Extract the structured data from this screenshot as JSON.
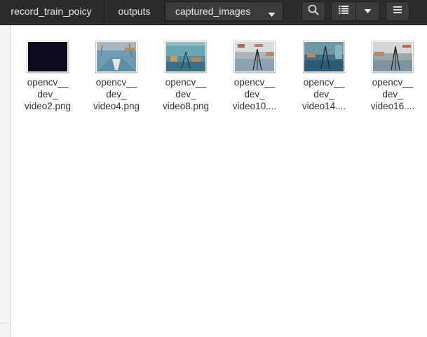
{
  "path_bar": {
    "crumbs": [
      "record_train_poicy",
      "outputs",
      "captured_images"
    ],
    "dropdown_icon": "triangle-down-icon"
  },
  "toolbar": {
    "search_icon": "search-icon",
    "view_icon": "list-view-icon",
    "view_options_icon": "chevron-down-icon",
    "menu_icon": "hamburger-menu-icon"
  },
  "files": [
    {
      "line1": "opencv__",
      "line2": "dev_",
      "line3": "video2.png"
    },
    {
      "line1": "opencv__",
      "line2": "dev_",
      "line3": "video4.png"
    },
    {
      "line1": "opencv__",
      "line2": "dev_",
      "line3": "video8.png"
    },
    {
      "line1": "opencv__",
      "line2": "dev_",
      "line3": "video10...."
    },
    {
      "line1": "opencv__",
      "line2": "dev_",
      "line3": "video14...."
    },
    {
      "line1": "opencv__",
      "line2": "dev_",
      "line3": "video16...."
    }
  ]
}
